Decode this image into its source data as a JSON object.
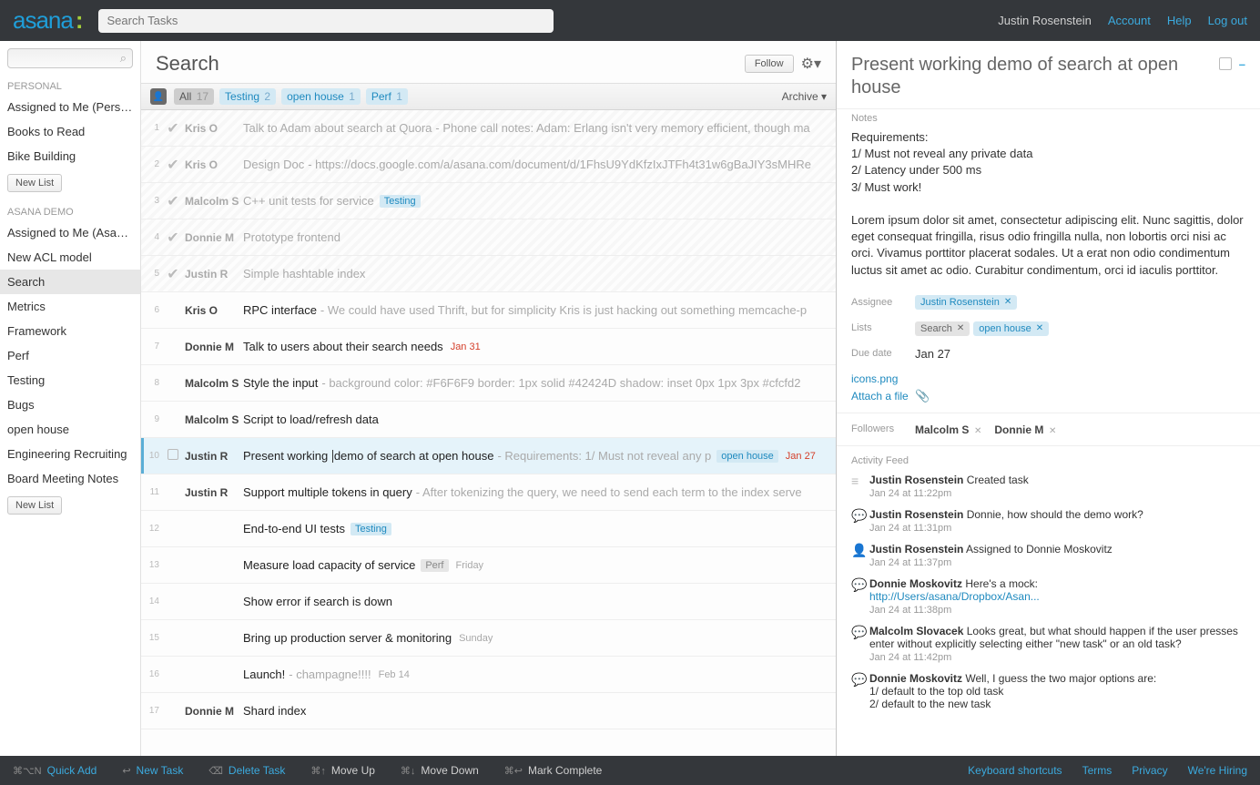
{
  "top": {
    "search_placeholder": "Search Tasks",
    "user": "Justin Rosenstein",
    "links": {
      "account": "Account",
      "help": "Help",
      "logout": "Log out"
    }
  },
  "sidebar": {
    "personal_label": "PERSONAL",
    "personal_items": [
      "Assigned to Me (Personal)",
      "Books to Read",
      "Bike Building"
    ],
    "new_list": "New List",
    "workspace_label": "ASANA DEMO",
    "workspace_items": [
      "Assigned to Me (Asana DEMO)",
      "New ACL model",
      "Search",
      "Metrics",
      "Framework",
      "Perf",
      "Testing",
      "Bugs",
      "open house",
      "Engineering Recruiting",
      "Board Meeting Notes"
    ],
    "selected_index": 2,
    "locked_index": 0
  },
  "center": {
    "title": "Search",
    "follow": "Follow",
    "filters": [
      {
        "label": "All",
        "count": "17",
        "kind": "active"
      },
      {
        "label": "Testing",
        "count": "2",
        "kind": "blue"
      },
      {
        "label": "open house",
        "count": "1",
        "kind": "blue"
      },
      {
        "label": "Perf",
        "count": "1",
        "kind": "blue"
      }
    ],
    "archive": "Archive",
    "tasks": [
      {
        "n": "1",
        "assn": "Kris O",
        "done": true,
        "title": "Talk to Adam about search at Quora",
        "extra": " - Phone call notes: Adam: Erlang isn't very memory efficient, though ma"
      },
      {
        "n": "2",
        "assn": "Kris O",
        "done": true,
        "title": "Design Doc",
        "extra": " - https://docs.google.com/a/asana.com/document/d/1FhsU9YdKfzIxJTFh4t31w6gBaJIY3sMHRe"
      },
      {
        "n": "3",
        "assn": "Malcolm S",
        "done": true,
        "title": "C++ unit tests for service",
        "tag": "Testing"
      },
      {
        "n": "4",
        "assn": "Donnie M",
        "done": true,
        "title": "Prototype frontend"
      },
      {
        "n": "5",
        "assn": "Justin R",
        "done": true,
        "title": "Simple hashtable index"
      },
      {
        "n": "6",
        "assn": "Kris O",
        "title": "RPC interface",
        "extra": " - We could have used Thrift, but for simplicity Kris is just hacking out something memcache-p"
      },
      {
        "n": "7",
        "assn": "Donnie M",
        "title": "Talk to users about their search needs",
        "date": "Jan 31",
        "date_red": true
      },
      {
        "n": "8",
        "assn": "Malcolm S",
        "title": "Style the input",
        "extra": " - background color: #F6F6F9 border: 1px solid #42424D shadow: inset 0px 1px 3px #cfcfd2"
      },
      {
        "n": "9",
        "assn": "Malcolm S",
        "title": "Script to load/refresh data"
      },
      {
        "n": "10",
        "assn": "Justin R",
        "title": "Present working demo of search at open house",
        "extra": " - Requirements: 1/ Must not reveal any p",
        "tag": "open house",
        "date": "Jan 27",
        "date_red": true,
        "sel": true,
        "cursor": true
      },
      {
        "n": "11",
        "assn": "Justin R",
        "title": "Support multiple tokens in query",
        "extra": " - After tokenizing the query, we need to send each term to the index serve"
      },
      {
        "n": "12",
        "assn": "",
        "title": "End-to-end UI tests",
        "tag": "Testing"
      },
      {
        "n": "13",
        "assn": "",
        "title": "Measure load capacity of service",
        "tag": "Perf",
        "tag_gray": true,
        "date": "Friday"
      },
      {
        "n": "14",
        "assn": "",
        "title": "Show error if search is down"
      },
      {
        "n": "15",
        "assn": "",
        "title": "Bring up production server & monitoring",
        "date": "Sunday"
      },
      {
        "n": "16",
        "assn": "",
        "title": "Launch!",
        "extra": " - champagne!!!!",
        "date": "Feb 14"
      },
      {
        "n": "17",
        "assn": "Donnie M",
        "title": "Shard index"
      }
    ]
  },
  "detail": {
    "title": "Present working demo of search at open house",
    "notes_label": "Notes",
    "notes_body": "Requirements:\n1/ Must not reveal any private data\n2/ Latency under 500 ms\n3/ Must work!\n\nLorem ipsum dolor sit amet, consectetur adipiscing elit. Nunc sagittis, dolor eget consequat fringilla, risus odio fringilla nulla, non lobortis orci nisi ac orci. Vivamus porttitor placerat sodales. Ut a erat non odio condimentum luctus sit amet ac odio. Curabitur condimentum, orci id iaculis porttitor.",
    "assignee_label": "Assignee",
    "assignee": "Justin Rosenstein",
    "lists_label": "Lists",
    "lists": [
      "Search",
      "open house"
    ],
    "due_label": "Due date",
    "due_value": "Jan 27",
    "file": "icons.png",
    "attach": "Attach a file",
    "followers_label": "Followers",
    "followers": [
      "Malcolm S",
      "Donnie M"
    ],
    "feed_label": "Activity Feed",
    "feed": [
      {
        "icon": "list",
        "who": "Justin Rosenstein",
        "txt": "Created task",
        "time": "Jan 24 at 11:22pm"
      },
      {
        "icon": "comment",
        "who": "Justin Rosenstein",
        "txt": "Donnie, how should the demo work?",
        "time": "Jan 24 at 11:31pm"
      },
      {
        "icon": "assign",
        "who": "Justin Rosenstein",
        "txt": "Assigned to Donnie Moskovitz",
        "time": "Jan 24 at 11:37pm"
      },
      {
        "icon": "comment",
        "who": "Donnie Moskovitz",
        "txt": "Here's a mock:",
        "link": "http://Users/asana/Dropbox/Asan...",
        "time": "Jan 24 at 11:38pm"
      },
      {
        "icon": "comment",
        "who": "Malcolm Slovacek",
        "txt": "Looks great, but what should happen if the user presses enter without explicitly selecting either \"new task\" or an old task?",
        "time": "Jan 24 at 11:42pm"
      },
      {
        "icon": "comment",
        "who": "Donnie Moskovitz",
        "txt": "Well, I guess the two major options are:\n1/ default to the top old task\n2/ default to the new task"
      }
    ]
  },
  "bottom": {
    "items": [
      {
        "key": "⌘⌥N",
        "label": "Quick Add",
        "blue": true
      },
      {
        "key": "↩",
        "label": "New Task",
        "blue": true
      },
      {
        "key": "⌫",
        "label": "Delete Task",
        "blue": true
      },
      {
        "key": "⌘↑",
        "label": "Move Up"
      },
      {
        "key": "⌘↓",
        "label": "Move Down"
      },
      {
        "key": "⌘↩",
        "label": "Mark Complete"
      }
    ],
    "right": [
      "Keyboard shortcuts",
      "Terms",
      "Privacy",
      "We're Hiring"
    ]
  }
}
